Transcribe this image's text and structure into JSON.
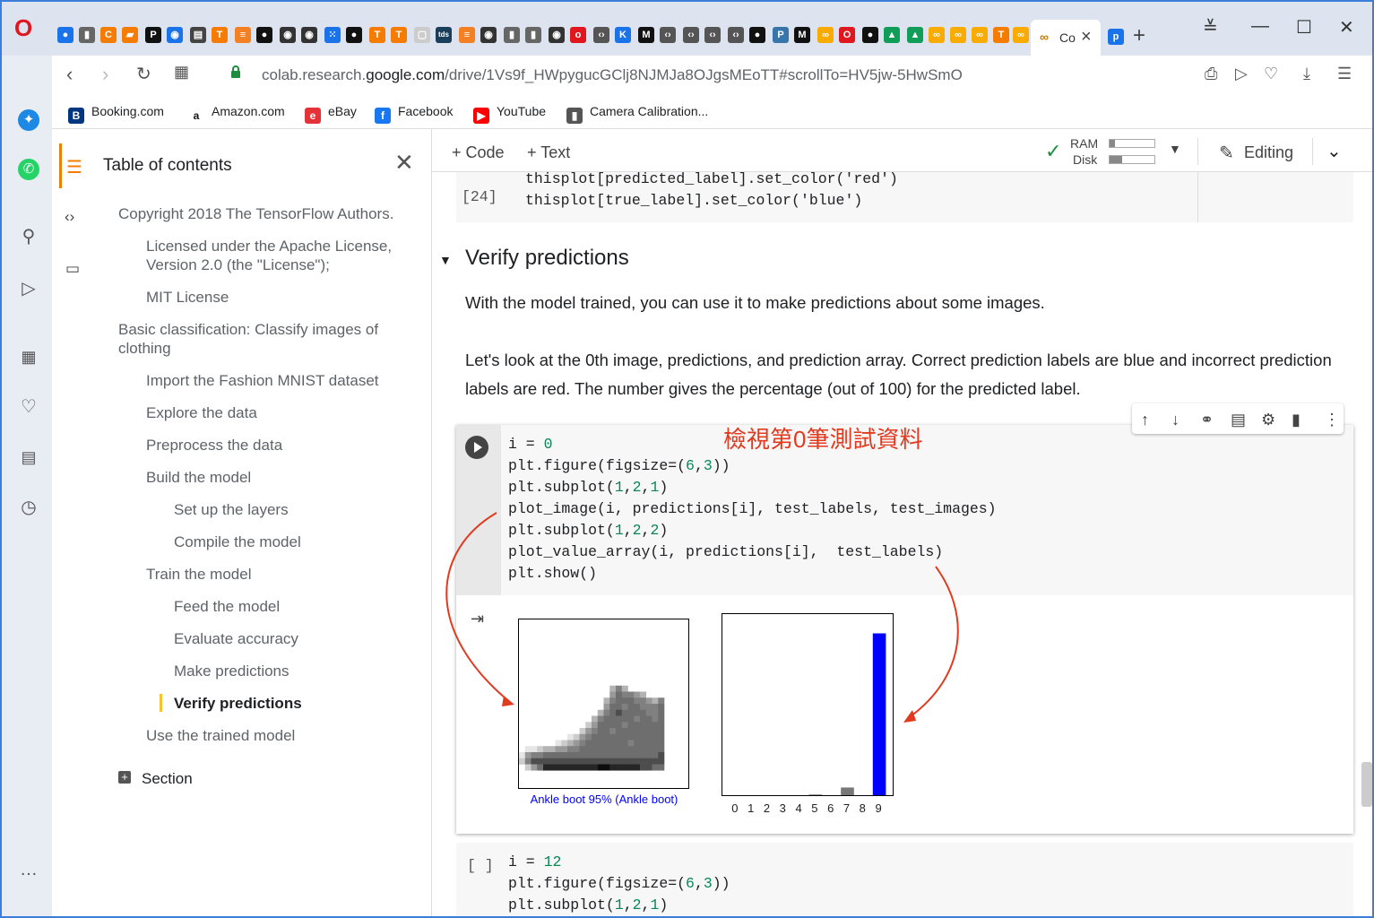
{
  "browser": {
    "tab_label_short": "Co",
    "url_prefix": "colab.research.",
    "url_domain": "google.com",
    "url_rest": "/drive/1Vs9f_HWpygucGClj8NJMJa8OJgsMEoTT#scrollTo=HV5jw-5HwSmO",
    "bookmarks": [
      "Booking.com",
      "Amazon.com",
      "eBay",
      "Facebook",
      "YouTube",
      "Camera Calibration..."
    ]
  },
  "toc": {
    "title": "Table of contents",
    "items": [
      "Copyright 2018 The TensorFlow Authors.",
      "Licensed under the Apache License, Version 2.0 (the \"License\");",
      "MIT License",
      "Basic classification: Classify images of clothing",
      "Import the Fashion MNIST dataset",
      "Explore the data",
      "Preprocess the data",
      "Build the model",
      "Set up the layers",
      "Compile the model",
      "Train the model",
      "Feed the model",
      "Evaluate accuracy",
      "Make predictions",
      "Verify predictions",
      "Use the trained model",
      "Section"
    ]
  },
  "toolbar": {
    "code_label": "+ Code",
    "text_label": "+ Text",
    "ram_label": "RAM",
    "disk_label": "Disk",
    "editing_label": "Editing"
  },
  "notebook": {
    "prev_cell_number": "[24]",
    "prev_line1": "thisplot[predicted_label].set_color('red')",
    "prev_line2": "thisplot[true_label].set_color('blue')",
    "section_heading": "Verify predictions",
    "para1": "With the model trained, you can use it to make predictions about some images.",
    "para2": "Let's look at the 0th image, predictions, and prediction array. Correct prediction labels are blue and incorrect prediction labels are red. The number gives the percentage (out of 100) for the predicted label.",
    "annotation": "檢視第0筆測試資料",
    "main_code": [
      "i = 0",
      "plt.figure(figsize=(6,3))",
      "plt.subplot(1,2,1)",
      "plot_image(i, predictions[i], test_labels, test_images)",
      "plt.subplot(1,2,2)",
      "plot_value_array(i, predictions[i],  test_labels)",
      "plt.show()"
    ],
    "image_caption": "Ankle boot 95% (Ankle boot)",
    "next_cell_number": "[ ]",
    "next_code": [
      "i = 12",
      "plt.figure(figsize=(6,3))",
      "plt.subplot(1,2,1)"
    ]
  },
  "chart_data": {
    "type": "bar",
    "categories": [
      "0",
      "1",
      "2",
      "3",
      "4",
      "5",
      "6",
      "7",
      "8",
      "9"
    ],
    "values": [
      0.0,
      0.0,
      0.0,
      0.0,
      0.0,
      0.004,
      0.0,
      0.045,
      0.0,
      0.95
    ],
    "ylim": [
      0,
      1
    ],
    "highlight_color": "#0000ff",
    "bar_color": "#777777",
    "title": "",
    "xlabel": "",
    "ylabel": ""
  },
  "colors": {
    "accent": "#f57c00",
    "annotation": "#e23a1e",
    "caption": "#0000ff"
  }
}
